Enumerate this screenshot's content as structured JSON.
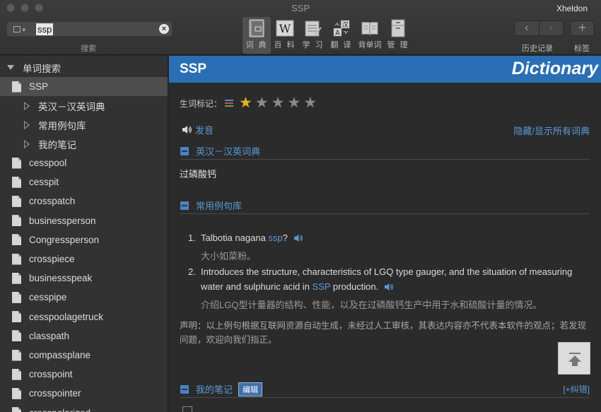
{
  "window": {
    "title": "SSP",
    "user": "Xheldon"
  },
  "search": {
    "value": "ssp",
    "caption": "搜索"
  },
  "toolbar": {
    "buttons": [
      {
        "label": "词 典"
      },
      {
        "label": "百 科"
      },
      {
        "label": "学 习"
      },
      {
        "label": "翻 译"
      },
      {
        "label": "背单词"
      },
      {
        "label": "管 理"
      }
    ],
    "history_caption": "历史记录",
    "bookmarks_caption": "标签"
  },
  "sidebar": {
    "root": "单词搜索",
    "current": "SSP",
    "groups": [
      "英汉－汉英词典",
      "常用例句库",
      "我的笔记"
    ],
    "words": [
      "cesspool",
      "cesspit",
      "crosspatch",
      "businessperson",
      "Congressperson",
      "crosspiece",
      "businessspeak",
      "cesspipe",
      "cesspoolagetruck",
      "classpath",
      "compassplane",
      "crosspoint",
      "crosspointer",
      "crosspolarized"
    ]
  },
  "entry": {
    "word": "SSP",
    "brand": "Dictionary",
    "tag_label": "生词标记：",
    "rating": {
      "value": 1,
      "max": 5
    },
    "pronounce": "发音",
    "toggle_all": "隐藏/显示所有词典",
    "sections": {
      "dict": {
        "title": "英汉－汉英词典",
        "definition": "过磷酸钙"
      },
      "examples": {
        "title": "常用例句库",
        "items": [
          {
            "num": "1.",
            "pre": "Talbotia nagana ",
            "kw": "ssp",
            "post": "?",
            "zh": "大小如菜粉。"
          },
          {
            "num": "2.",
            "pre": "Introduces the structure, characteristics of LGQ type gauger, and the situation of measuring water and sulphuric acid in ",
            "kw": "SSP",
            "post": " production.",
            "zh": "介绍LGQ型计量器的结构、性能，以及在过磷酸钙生产中用于水和硫酸计量的情况。"
          }
        ],
        "disclaimer": "声明：以上例句根据互联网资源自动生成，未经过人工审核，其表达内容亦不代表本软件的观点；若发现问题，欢迎向我们指正。"
      },
      "notes": {
        "title": "我的笔记",
        "edit_label": "编辑",
        "fix_label": "[+纠错]"
      }
    }
  },
  "colors": {
    "accent": "#2a6fb3",
    "link": "#5a9ad6",
    "star_on": "#e5b324",
    "star_off": "#8a8a8a"
  }
}
